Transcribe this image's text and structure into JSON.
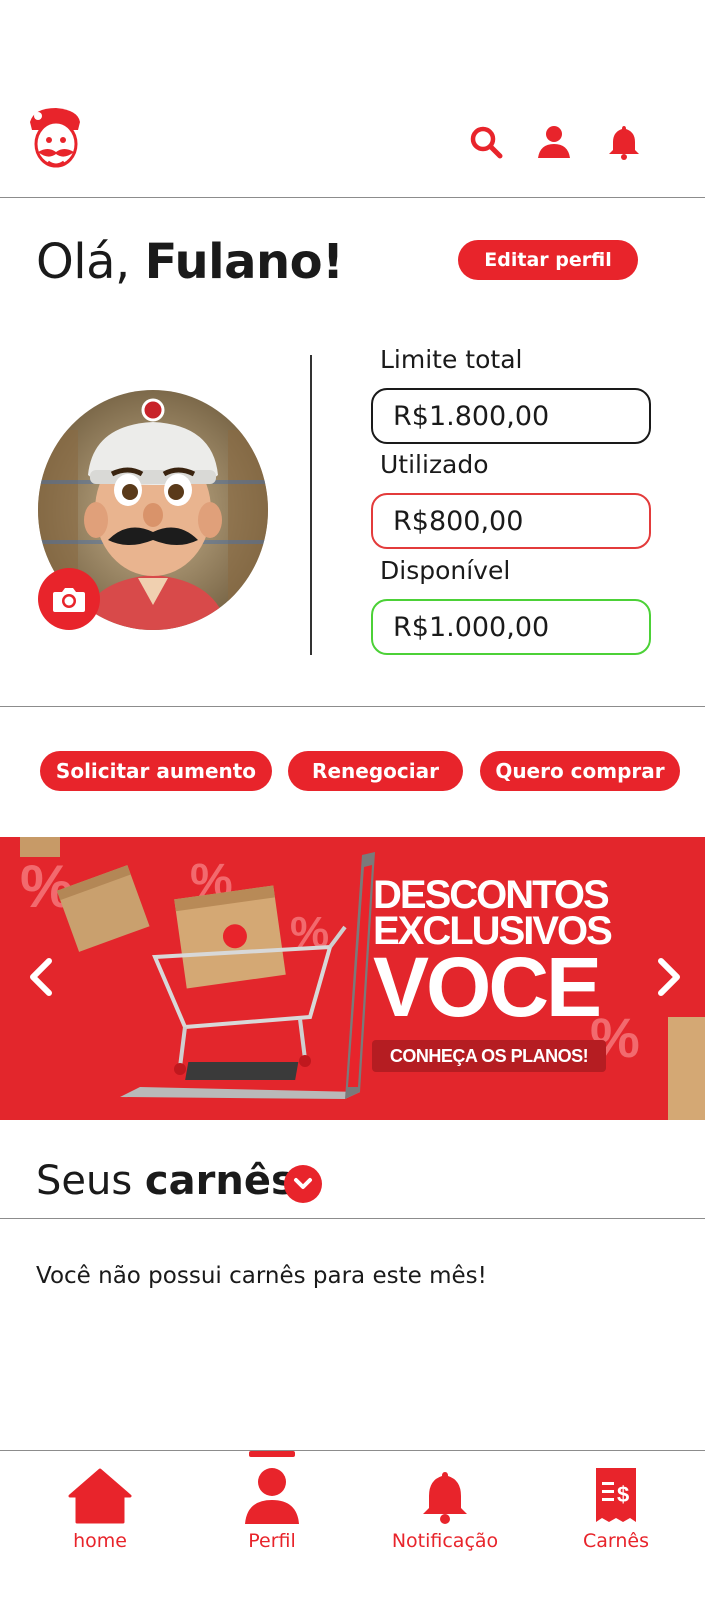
{
  "header": {
    "logo_icon": "mascot-logo",
    "icons": [
      "search-icon",
      "user-icon",
      "bell-icon"
    ]
  },
  "greeting": {
    "prefix": "Olá,",
    "name": "Fulano!"
  },
  "edit_profile_label": "Editar perfil",
  "limits": {
    "total_label": "Limite total",
    "total_value": "R$1.800,00",
    "used_label": "Utilizado",
    "used_value": "R$800,00",
    "available_label": "Disponível",
    "available_value": "R$1.000,00"
  },
  "actions": {
    "request_increase": "Solicitar aumento",
    "renegotiate": "Renegociar",
    "want_to_buy": "Quero comprar"
  },
  "banner": {
    "line1": "DESCONTOS",
    "line2": "EXCLUSIVOS",
    "line3": "VOCE",
    "cta": "CONHEÇA OS PLANOS!"
  },
  "carnes": {
    "title_prefix": "Seus",
    "title_bold": "carnês",
    "empty_message": "Você não possui carnês para este mês!"
  },
  "bottom_nav": {
    "items": [
      {
        "label": "home",
        "icon": "home-icon"
      },
      {
        "label": "Perfil",
        "icon": "profile-icon",
        "active": true
      },
      {
        "label": "Notificação",
        "icon": "bell-icon"
      },
      {
        "label": "Carnês",
        "icon": "receipt-icon"
      }
    ]
  },
  "colors": {
    "primary": "#e8242b",
    "used_border": "#e33b3b",
    "available_border": "#4cd137",
    "total_border": "#1a1a1a"
  }
}
